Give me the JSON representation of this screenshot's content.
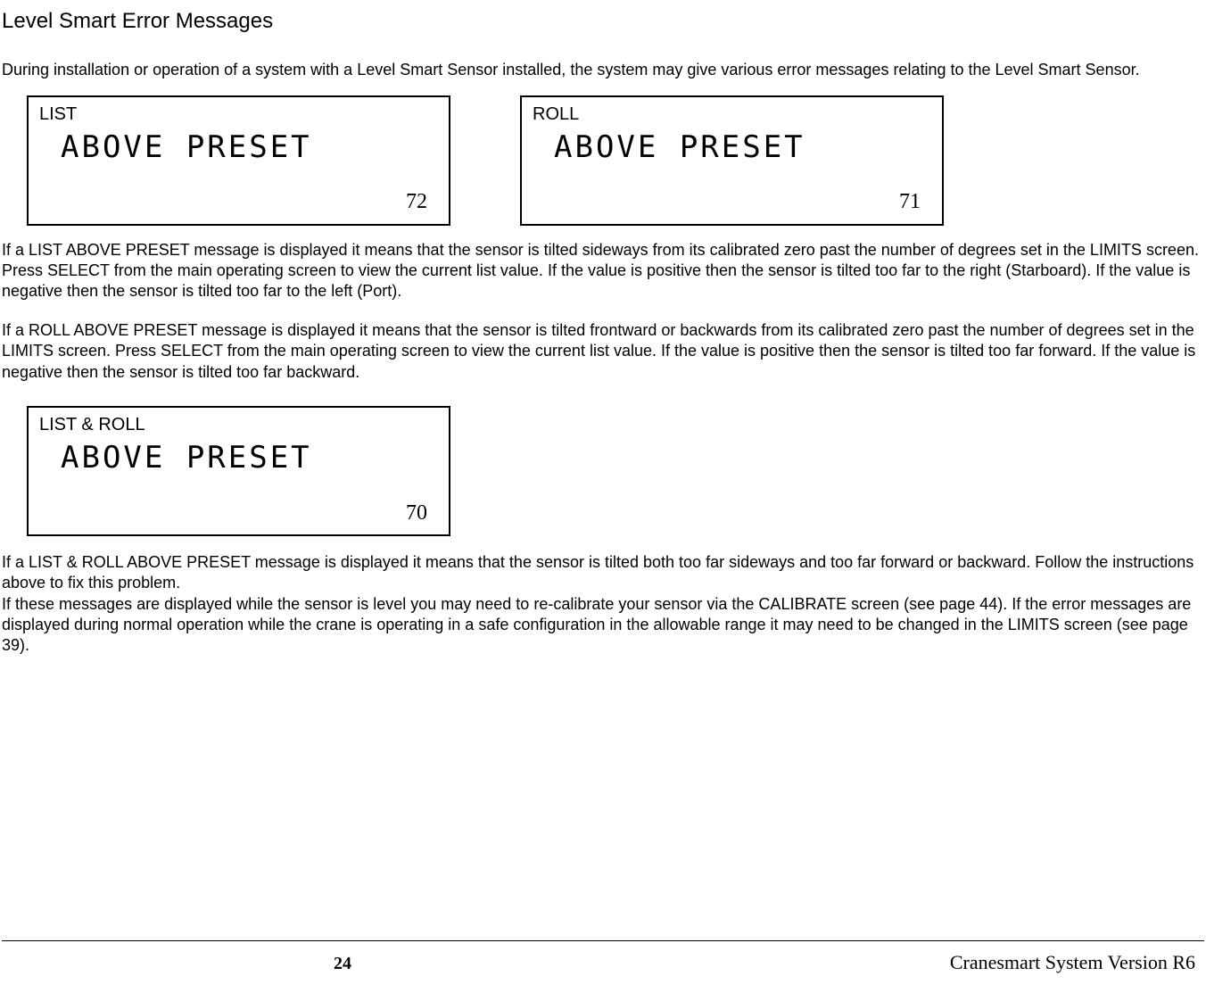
{
  "title": "Level Smart Error Messages",
  "intro": "During installation or operation of a system with a Level Smart Sensor installed, the system may give various error messages relating to the Level Smart Sensor.",
  "panels": [
    {
      "header": "LIST",
      "main": "ABOVE PRESET",
      "num": "72"
    },
    {
      "header": "ROLL",
      "main": "ABOVE PRESET",
      "num": "71"
    },
    {
      "header": "LIST & ROLL",
      "main": "ABOVE PRESET",
      "num": "70"
    }
  ],
  "para1": "If a LIST ABOVE PRESET message is displayed it means that the sensor is tilted sideways from its calibrated zero past the number of degrees set in the LIMITS screen.  Press SELECT from the main operating screen to view the current list value.  If the value is positive then the sensor is tilted too far to the right (Starboard).  If the value is negative then the sensor is tilted too far to the left (Port).",
  "para2": "If a ROLL ABOVE PRESET message is displayed it means that the sensor is tilted frontward or backwards from its calibrated zero past the number of degrees set in the LIMITS screen. Press SELECT from the main operating screen to view the current list value.  If the value is positive then the sensor is tilted too far forward.  If the value is negative then the sensor is tilted too far backward.",
  "para3": "If a LIST & ROLL ABOVE PRESET message is displayed it means that the sensor is tilted both too far sideways and too far forward or backward.  Follow the instructions above to fix this problem.",
  "para4": "If these messages are displayed while the sensor is level you may need to re-calibrate your sensor via the CALIBRATE screen (see page 44).  If the error messages are displayed during normal operation while the crane is operating in a safe configuration in the allowable range it may need to be changed in the LIMITS screen (see page 39).",
  "footer": {
    "page": "24",
    "version": "Cranesmart System Version R6"
  }
}
